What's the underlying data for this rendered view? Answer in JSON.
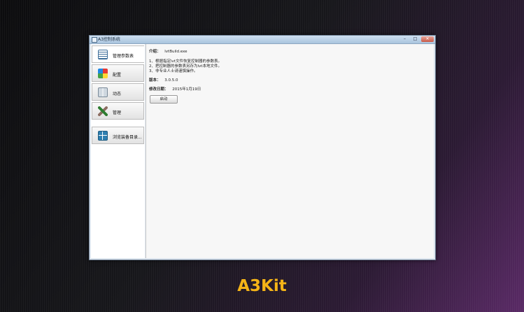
{
  "window": {
    "title": "A3控制系统",
    "buttons": {
      "minimize": "–",
      "maximize": "□",
      "close": "✕"
    }
  },
  "sidebar": {
    "items": [
      {
        "label": "管理参数表",
        "icon": "table-icon"
      },
      {
        "label": "配置",
        "icon": "palette-icon"
      },
      {
        "label": "动态",
        "icon": "book-icon"
      },
      {
        "label": "管理",
        "icon": "tools-icon"
      },
      {
        "label": "浏览装备目录...",
        "icon": "grid-icon"
      }
    ]
  },
  "info": {
    "intro_label": "介绍：",
    "intro_value": "lvtBuild.exe",
    "lines": [
      "1、根据指定lvt文件恢复控制器的参数表。",
      "2、把控制器的参数表另存为lvt本地文件。",
      "3、非专业人士请谨慎操作。"
    ],
    "version_label": "版本：",
    "version_value": "3.0.5.0",
    "date_label": "修改日期：",
    "date_value": "2015年1月19日",
    "start_button": "启动"
  },
  "caption": "A3Kit",
  "colors": {
    "caption": "#f5b417",
    "titlebar": "#a9c4de"
  }
}
